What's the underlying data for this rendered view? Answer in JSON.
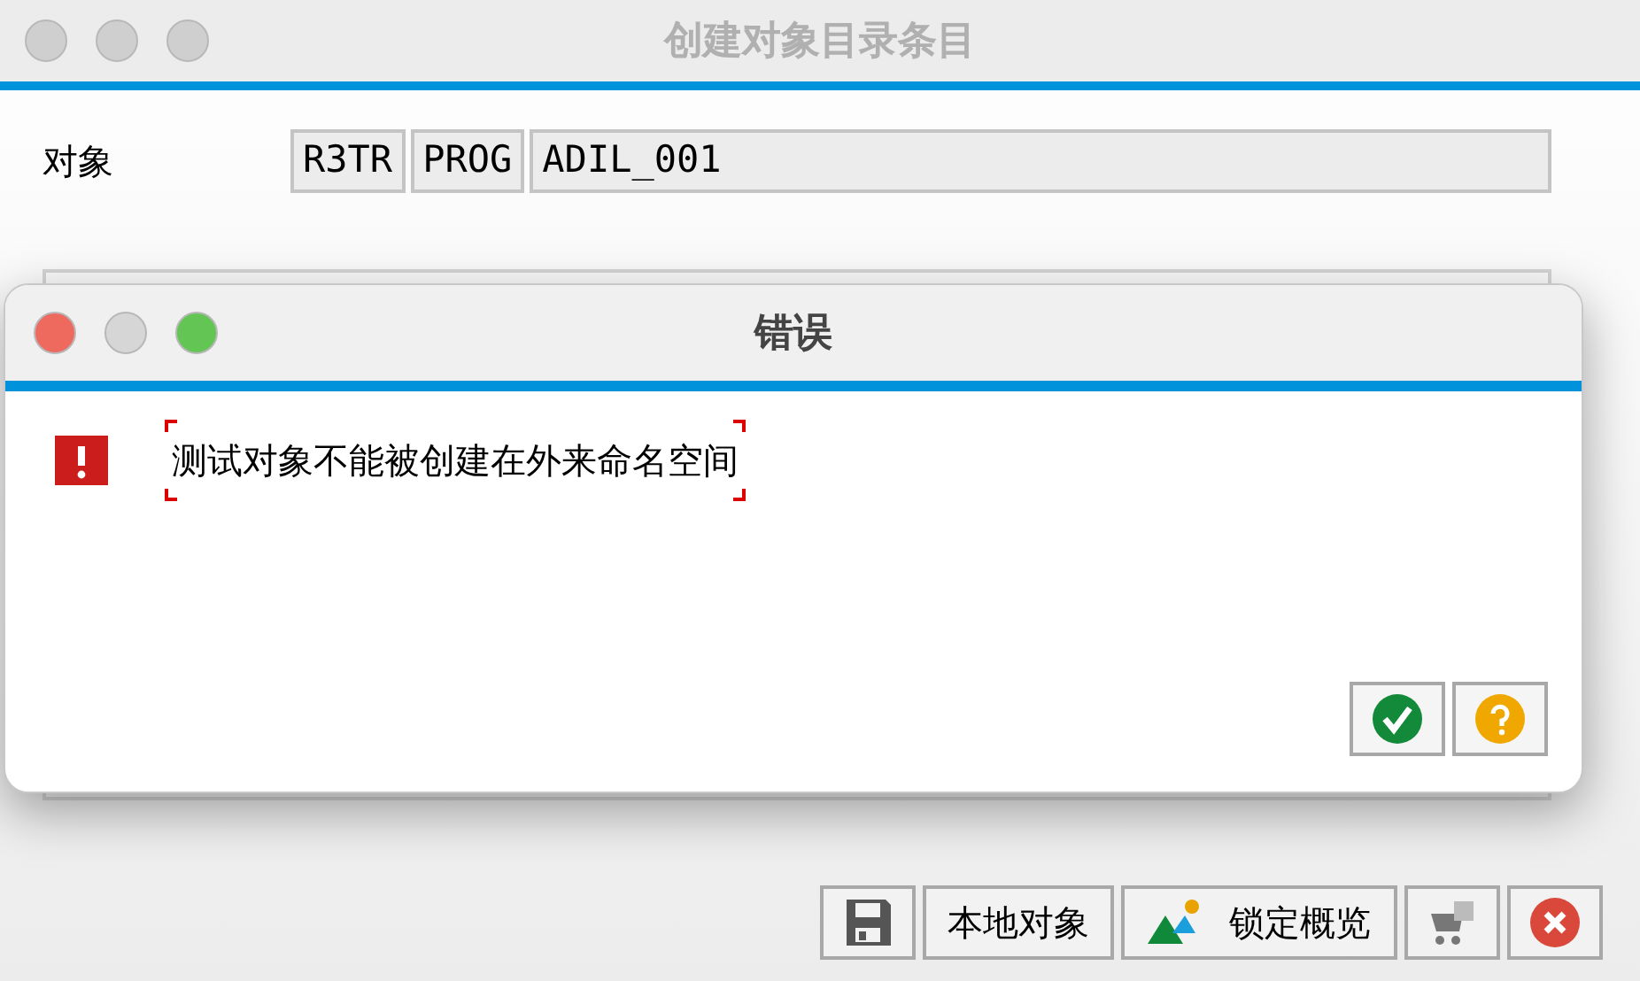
{
  "window": {
    "title": "创建对象目录条目"
  },
  "object": {
    "label": "对象",
    "fields": [
      "R3TR",
      "PROG",
      "ADIL_001"
    ]
  },
  "dialog": {
    "title": "错误",
    "message": "测试对象不能被创建在外来命名空间",
    "buttons": [
      {
        "kind": "confirm"
      },
      {
        "kind": "help"
      }
    ]
  },
  "toolbar": [
    {
      "kind": "save"
    },
    {
      "kind": "text",
      "label": "本地对象"
    },
    {
      "kind": "icon_text",
      "label": "锁定概览"
    },
    {
      "kind": "transport"
    },
    {
      "kind": "cancel"
    }
  ]
}
